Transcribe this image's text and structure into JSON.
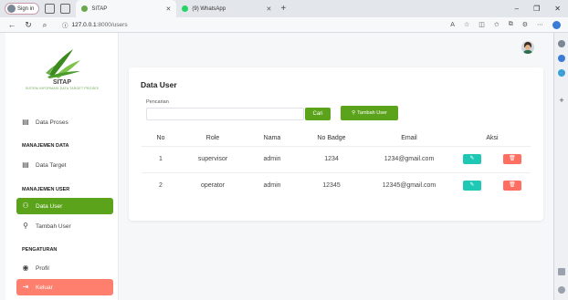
{
  "browser": {
    "signin_label": "Sign in",
    "tabs": [
      {
        "title": "SITAP",
        "active": true
      },
      {
        "title": "(9) WhatsApp",
        "active": false
      }
    ],
    "url_host": "127.0.0.1",
    "url_path": ":8000/users"
  },
  "sidebar": {
    "brand": "SITAP",
    "tagline": "SISTEM INFORMASI DATA TARGET PROSES",
    "items": [
      {
        "label": "Data Proses"
      },
      {
        "label": "Data Target"
      },
      {
        "label": "Data User"
      },
      {
        "label": "Tambah User"
      },
      {
        "label": "Profil"
      },
      {
        "label": "Keluar"
      }
    ],
    "sections": {
      "data": "MANAJEMEN DATA",
      "user": "MANAJEMEN USER",
      "settings": "PENGATURAN"
    }
  },
  "main": {
    "title": "Data User",
    "search_label": "Pencarian",
    "search_value": "",
    "search_placeholder": "",
    "search_button": "Cari",
    "add_button": "Tambah User",
    "columns": [
      "No",
      "Role",
      "Nama",
      "No Badge",
      "Email",
      "Aksi"
    ],
    "rows": [
      {
        "no": "1",
        "role": "supervisor",
        "nama": "admin",
        "badge": "1234",
        "email": "1234@gmail.com"
      },
      {
        "no": "2",
        "role": "operator",
        "nama": "admin",
        "badge": "12345",
        "email": "12345@gmail.com"
      }
    ]
  },
  "colors": {
    "accent": "#5aa31a",
    "edit": "#1ec8b4",
    "delete": "#ff6f61",
    "logout": "#ff7f6e"
  }
}
